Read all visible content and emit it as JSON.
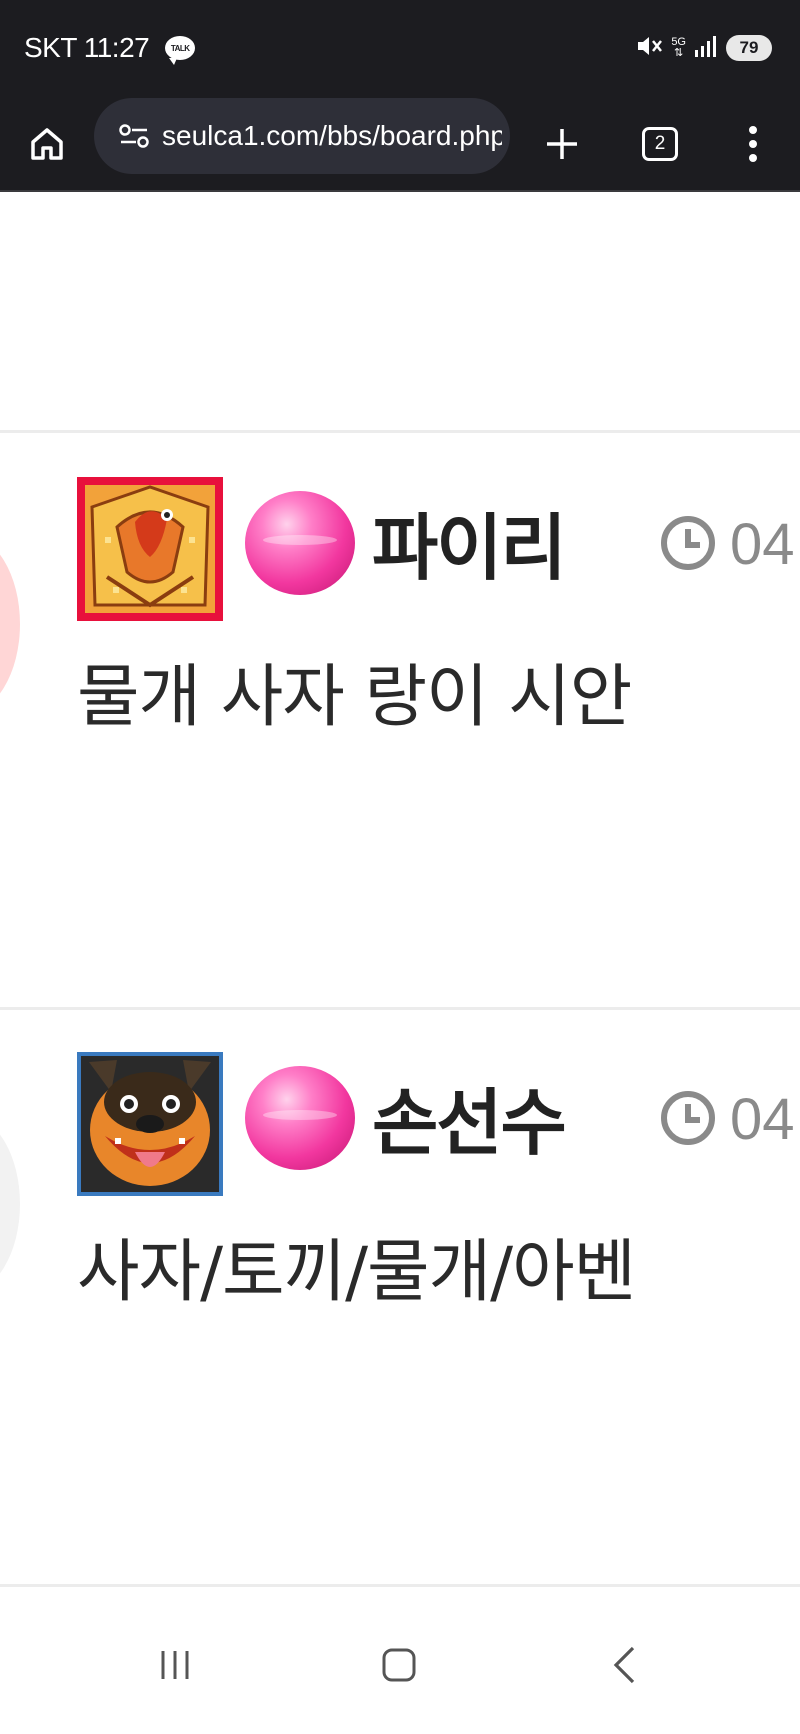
{
  "status_bar": {
    "carrier_time": "SKT 11:27",
    "talk_badge": "TALK",
    "network": "5G",
    "battery": "79"
  },
  "browser": {
    "url": "seulca1.com/bbs/board.php",
    "tab_count": "2"
  },
  "comments": [
    {
      "nickname": "파이리",
      "time": "04",
      "body": "물개 사자 랑이 시안",
      "avatar_icon": "fire-pixel-avatar-icon",
      "level_icon": "pink-orb-level-icon"
    },
    {
      "nickname": "손선수",
      "time": "04",
      "body": "사자/토끼/물개/아벤",
      "avatar_icon": "dog-pixel-avatar-icon",
      "level_icon": "pink-orb-level-icon"
    }
  ],
  "nav": {
    "icons": [
      "recent-apps-icon",
      "home-icon",
      "back-icon"
    ]
  },
  "colors": {
    "status_bg": "#1c1c20",
    "url_bar_bg": "#2e2f38",
    "level_orb": "#f2379f",
    "nickname": "#222222",
    "time": "#8a8a8a"
  }
}
